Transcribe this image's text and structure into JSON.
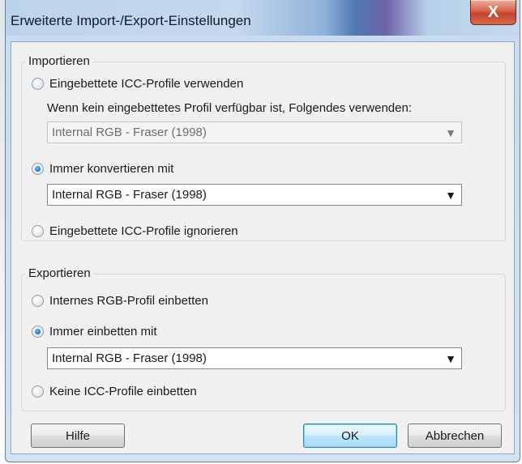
{
  "window": {
    "title": "Erweiterte Import-/Export-Einstellungen",
    "close_label": "X"
  },
  "import_group": {
    "legend": "Importieren",
    "opt_embedded": "Eingebettete ICC-Profile verwenden",
    "fallback_hint": "Wenn kein eingebettetes Profil verfügbar ist, Folgendes verwenden:",
    "fallback_value": "Internal RGB - Fraser (1998)",
    "opt_always_convert": "Immer konvertieren mit",
    "convert_value": "Internal RGB - Fraser (1998)",
    "opt_ignore": "Eingebettete ICC-Profile ignorieren",
    "selected": "always_convert"
  },
  "export_group": {
    "legend": "Exportieren",
    "opt_internal": "Internes RGB-Profil einbetten",
    "opt_always_embed": "Immer einbetten mit",
    "embed_value": "Internal RGB - Fraser (1998)",
    "opt_none": "Keine ICC-Profile einbetten",
    "selected": "always_embed"
  },
  "buttons": {
    "help": "Hilfe",
    "ok": "OK",
    "cancel": "Abbrechen"
  },
  "icons": {
    "dropdown": "▼",
    "close": "X"
  }
}
